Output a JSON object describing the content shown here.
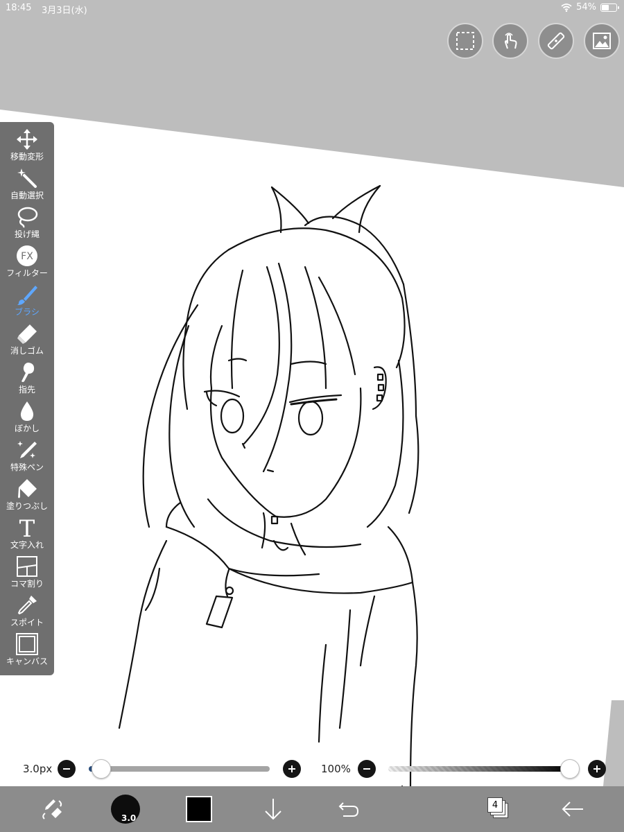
{
  "status": {
    "time": "18:45",
    "date": "3月3日(水)",
    "battery": "54%",
    "battery_level": 0.54
  },
  "top_buttons": [
    {
      "icon": "selection-icon"
    },
    {
      "icon": "touch-icon"
    },
    {
      "icon": "ruler-icon"
    },
    {
      "icon": "image-icon"
    }
  ],
  "tools": [
    {
      "label": "移動変形",
      "icon": "move-arrows-icon"
    },
    {
      "label": "自動選択",
      "icon": "magic-wand-icon"
    },
    {
      "label": "投げ縄",
      "icon": "lasso-icon"
    },
    {
      "label": "フィルター",
      "icon": "fx-icon",
      "icon_text": "FX"
    },
    {
      "label": "ブラシ",
      "icon": "brush-icon",
      "active": true
    },
    {
      "label": "消しゴム",
      "icon": "eraser-icon"
    },
    {
      "label": "指先",
      "icon": "finger-icon"
    },
    {
      "label": "ぼかし",
      "icon": "blur-drop-icon"
    },
    {
      "label": "特殊ペン",
      "icon": "special-pen-icon"
    },
    {
      "label": "塗りつぶし",
      "icon": "fill-bucket-icon"
    },
    {
      "label": "文字入れ",
      "icon": "text-icon",
      "icon_text": "T"
    },
    {
      "label": "コマ割り",
      "icon": "frame-divide-icon"
    },
    {
      "label": "スポイト",
      "icon": "eyedropper-icon"
    },
    {
      "label": "キャンバス",
      "icon": "canvas-icon"
    }
  ],
  "brush_size": {
    "label": "3.0px",
    "value": 0.07
  },
  "opacity": {
    "label": "100%",
    "value": 1.0
  },
  "bottom_bar": {
    "brush_size_text": "3.0",
    "color": "#000000",
    "layer_count": "4"
  },
  "colors": {
    "active_tool": "#5ea7ff",
    "slider_fill": "#2b4f7e"
  }
}
